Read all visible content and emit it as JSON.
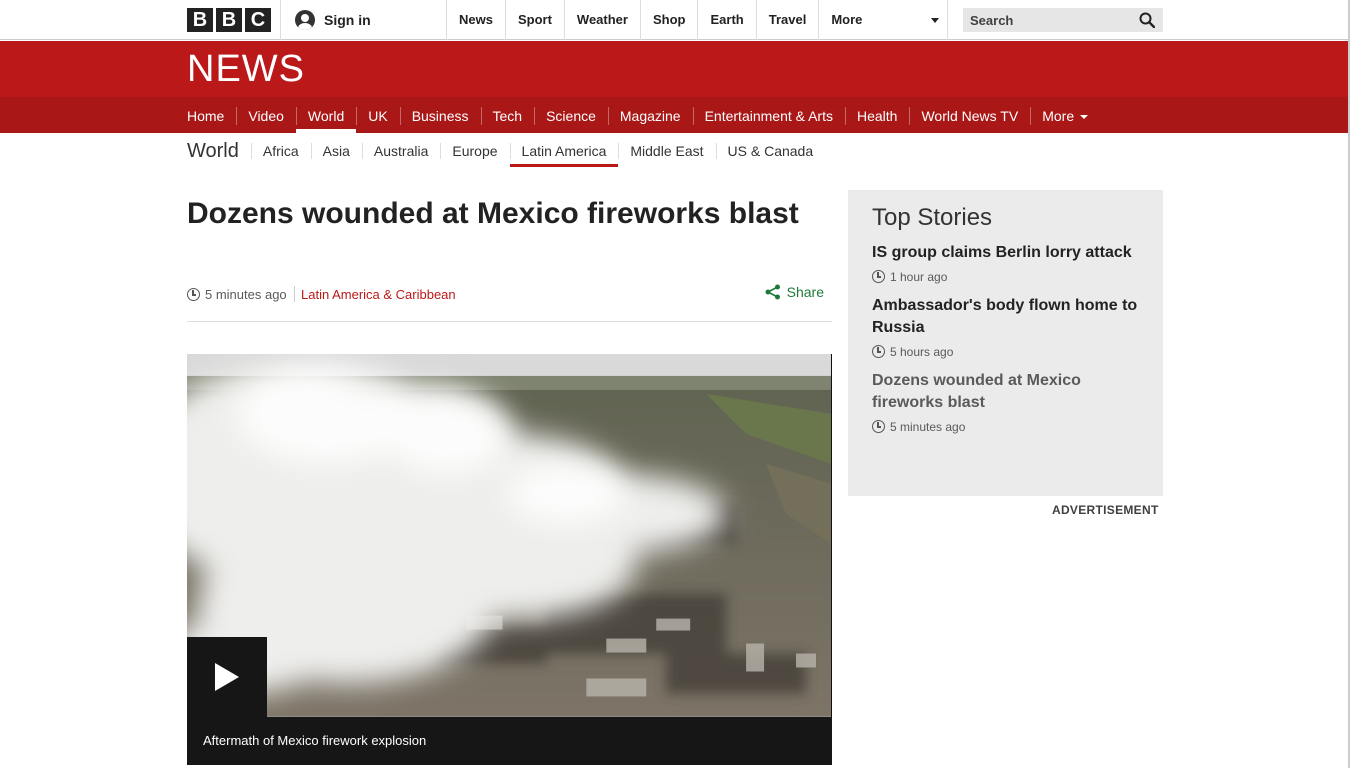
{
  "header": {
    "logo": [
      "B",
      "B",
      "C"
    ],
    "sign_in": "Sign in",
    "nav": [
      "News",
      "Sport",
      "Weather",
      "Shop",
      "Earth",
      "Travel"
    ],
    "more": "More",
    "search_placeholder": "Search"
  },
  "banner": {
    "title": "NEWS"
  },
  "main_nav": {
    "items": [
      "Home",
      "Video",
      "World",
      "UK",
      "Business",
      "Tech",
      "Science",
      "Magazine",
      "Entertainment & Arts",
      "Health",
      "World News TV"
    ],
    "more": "More",
    "active": "World"
  },
  "sub_nav": {
    "section": "World",
    "items": [
      "Africa",
      "Asia",
      "Australia",
      "Europe",
      "Latin America",
      "Middle East",
      "US & Canada"
    ],
    "active": "Latin America"
  },
  "article": {
    "headline": "Dozens wounded at Mexico fireworks blast",
    "time": "5 minutes ago",
    "category": "Latin America & Caribbean",
    "share": "Share",
    "caption": "Aftermath of Mexico firework explosion"
  },
  "top_stories": {
    "heading": "Top Stories",
    "stories": [
      {
        "title": "IS group claims Berlin lorry attack",
        "time": "1 hour ago"
      },
      {
        "title": "Ambassador's body flown home to Russia",
        "time": "5 hours ago"
      },
      {
        "title": "Dozens wounded at Mexico fireworks blast",
        "time": "5 minutes ago"
      }
    ]
  },
  "advertisement_label": "ADVERTISEMENT",
  "colors": {
    "brand_red": "#bb1919",
    "nav_red": "#a91717",
    "share_green": "#1f7a3a"
  }
}
